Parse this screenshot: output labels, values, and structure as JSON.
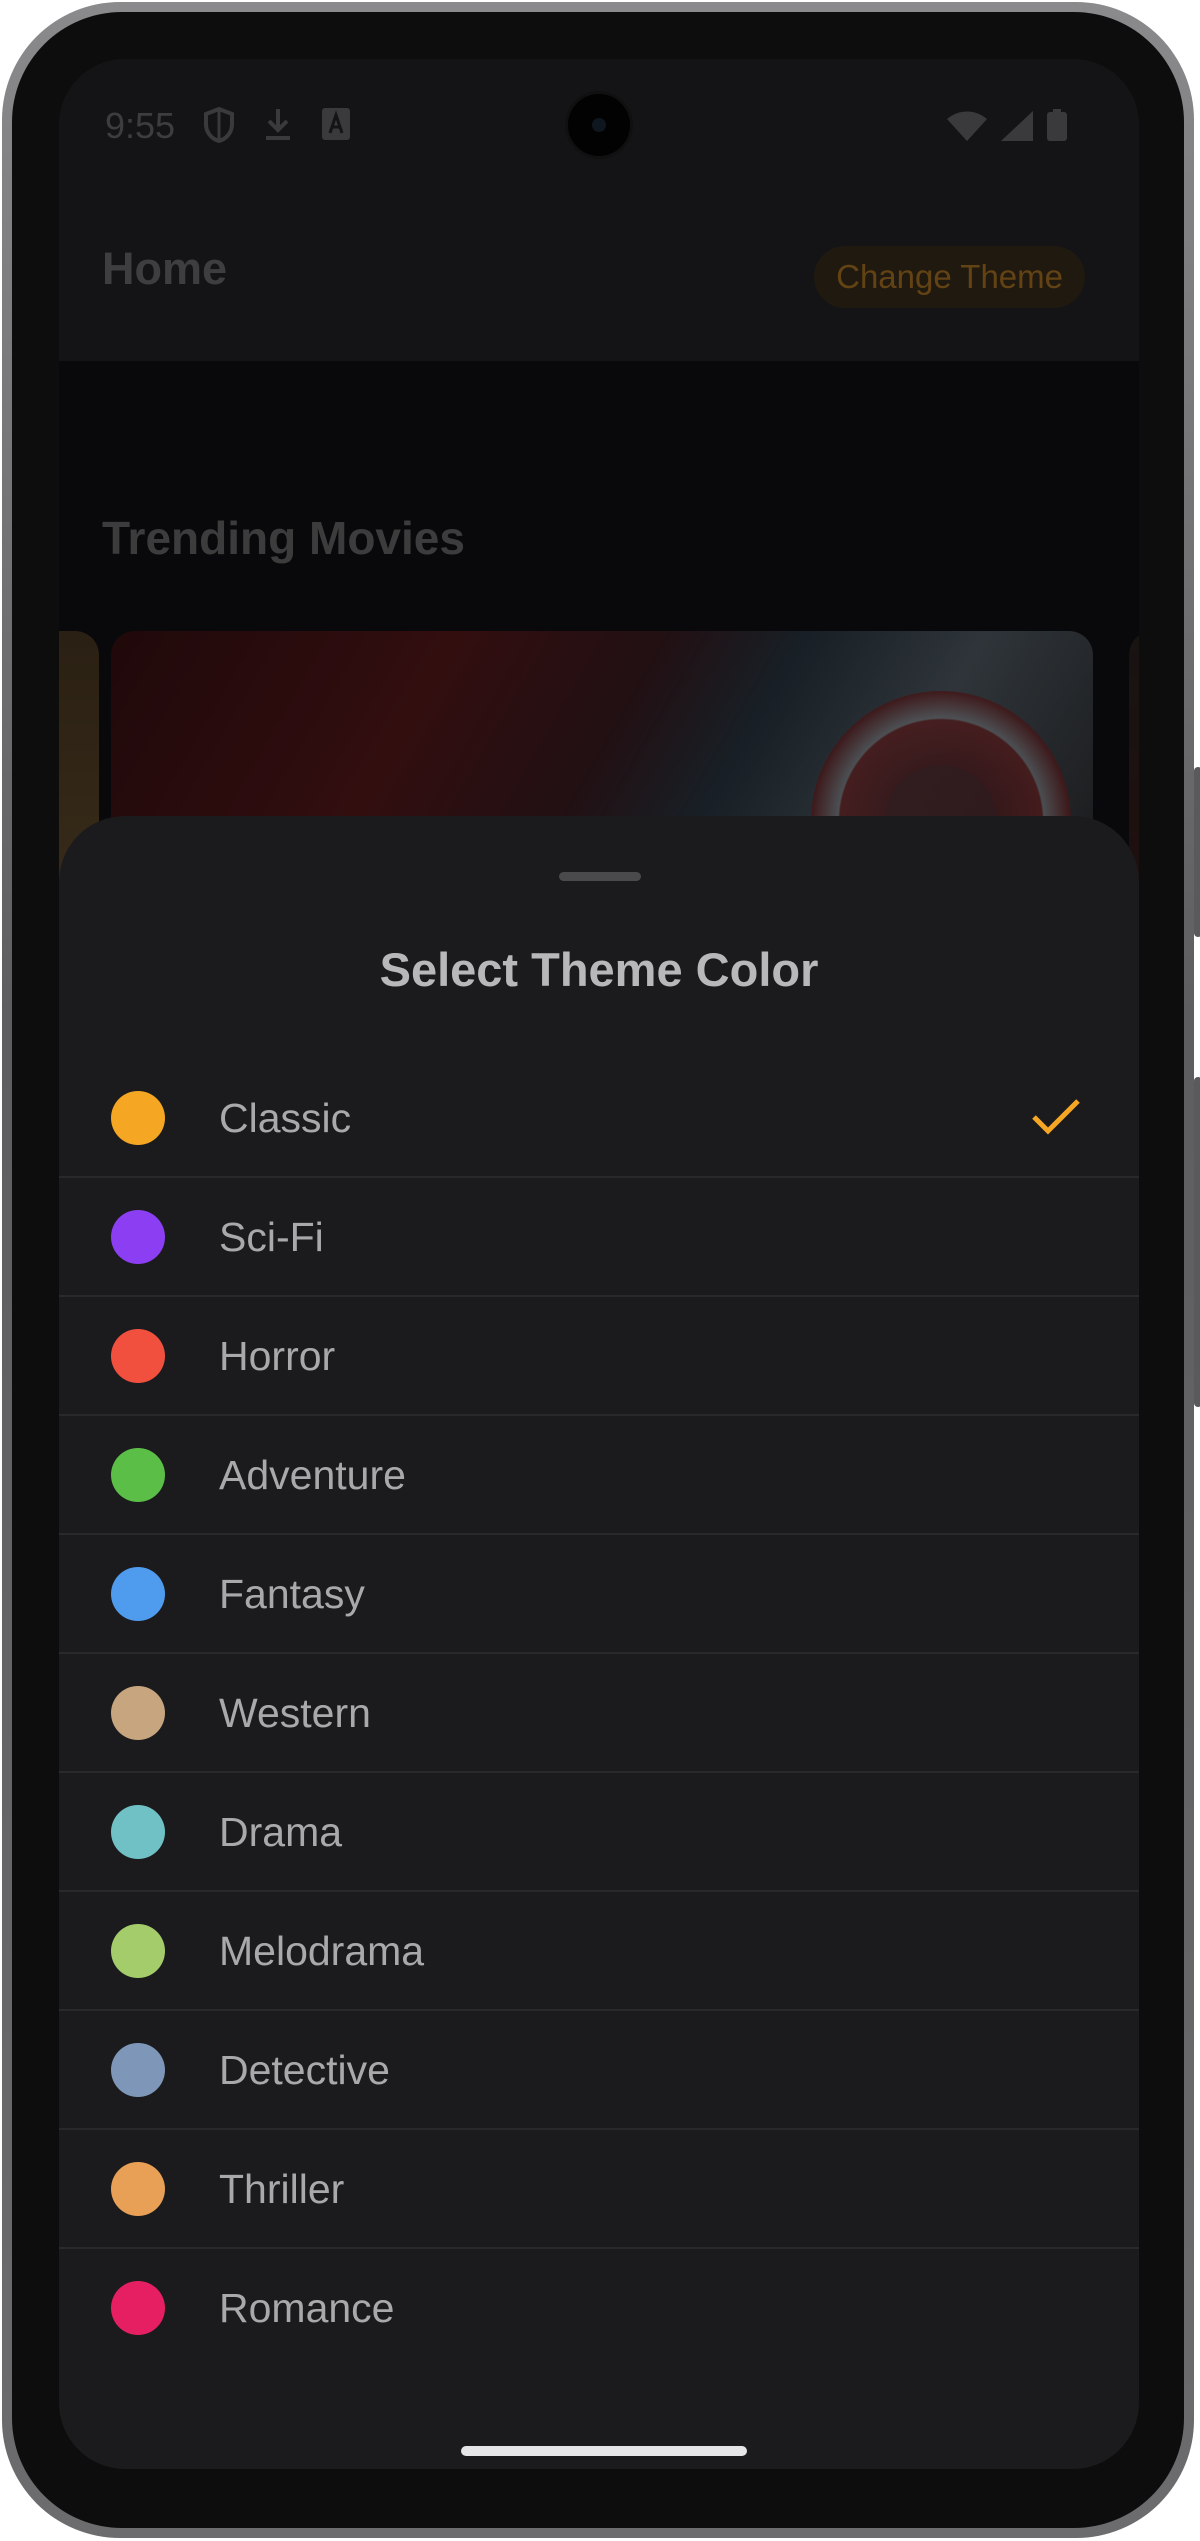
{
  "status_bar": {
    "time": "9:55",
    "left_icons": [
      "shield-icon",
      "download-icon",
      "font-a-icon"
    ],
    "right_icons": [
      "wifi-icon",
      "signal-icon",
      "battery-icon"
    ]
  },
  "app_bar": {
    "title": "Home",
    "change_theme_label": "Change Theme"
  },
  "main": {
    "section_title": "Trending Movies"
  },
  "sheet": {
    "title": "Select Theme Color",
    "selected": "Classic",
    "themes": [
      {
        "label": "Classic",
        "color": "#F5A623"
      },
      {
        "label": "Sci-Fi",
        "color": "#8C3FF2"
      },
      {
        "label": "Horror",
        "color": "#F2503F"
      },
      {
        "label": "Adventure",
        "color": "#5BBF47"
      },
      {
        "label": "Fantasy",
        "color": "#4F9BEE"
      },
      {
        "label": "Western",
        "color": "#C7A57E"
      },
      {
        "label": "Drama",
        "color": "#70C1C6"
      },
      {
        "label": "Melodrama",
        "color": "#A4CC6B"
      },
      {
        "label": "Detective",
        "color": "#7E97B8"
      },
      {
        "label": "Thriller",
        "color": "#E8A056"
      },
      {
        "label": "Romance",
        "color": "#E61E62"
      }
    ]
  },
  "colors": {
    "accent": "#F5A623",
    "sheet_bg": "#1B1B1D",
    "app_bar_bg": "#262628"
  }
}
